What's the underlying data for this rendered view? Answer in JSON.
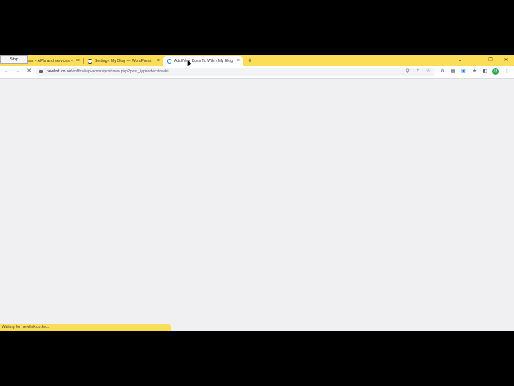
{
  "tooltip": {
    "label": "Stop"
  },
  "tabs": [
    {
      "title": "als – APIs and services –",
      "active": false
    },
    {
      "title": "Setting ‹ My Blog — WordPress",
      "active": false
    },
    {
      "title": "Add New Docs To Wiki ‹ My Blog",
      "active": true
    }
  ],
  "new_tab_label": "+",
  "window_controls": {
    "tab_search": "⌄",
    "minimize": "–",
    "restore": "❐",
    "close": "✕"
  },
  "toolbar": {
    "back": "←",
    "forward": "→",
    "stop": "✕"
  },
  "omnibox": {
    "host": "newlink.co.ke",
    "path": "/woffice/wp-admin/post-new.php?post_type=docstowiki"
  },
  "omnibox_icons": {
    "zoom": "⚲",
    "share": "⇪",
    "bookmark": "☆"
  },
  "extensions": {
    "ext1": "⚙",
    "ext2": "▦",
    "ext3": "▣",
    "puzzle": "✚",
    "sidebar": "◧",
    "menu": "⋮"
  },
  "avatar_letter": "U",
  "status": {
    "text": "Waiting for newlink.co.ke..."
  },
  "colors": {
    "tabstrip": "#fcdd58",
    "toolbar": "#ffffff",
    "content": "#f0f0f3",
    "accent": "#1a73e8"
  }
}
